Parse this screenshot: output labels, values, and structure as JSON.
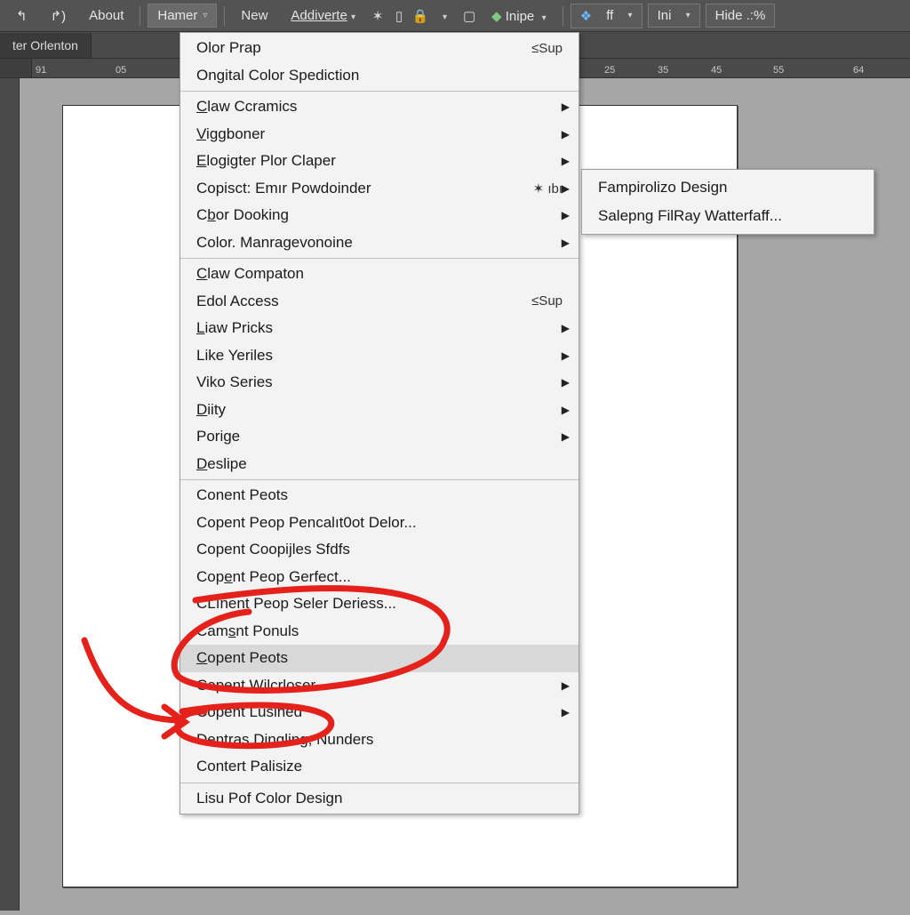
{
  "menubar": {
    "undo_redo": "↰",
    "redo": "↱",
    "about": "About",
    "hamer": "Hamer",
    "new": "New",
    "addiverte": "Addiverte",
    "inipe": "Inipe",
    "ff": "ff",
    "ini": "Ini",
    "hide": "Hide .:%"
  },
  "tab": {
    "title": "ter Orlenton"
  },
  "ruler": {
    "marks": [
      "91",
      "05",
      "25",
      "35",
      "45",
      "55",
      "64"
    ]
  },
  "menu": {
    "section1": [
      {
        "label": "Olor Prap",
        "shortcut": "≤Sup"
      },
      {
        "label": "Ongital Color Spediction"
      }
    ],
    "section2": [
      {
        "label": "Claw Ccramics",
        "u": 0,
        "sub": true
      },
      {
        "label": "Viggboner",
        "u": 0,
        "sub": true
      },
      {
        "label": "Elogigter Plor Claper",
        "u": 0,
        "sub": true
      },
      {
        "label": "Copisct: Emır Powdoinder",
        "shortcut": "✶ ıbı",
        "sub": true
      },
      {
        "label": "Cbor Dooking",
        "u": 1,
        "sub": true
      },
      {
        "label": "Color. Manragevonoine",
        "sub": true
      }
    ],
    "section3": [
      {
        "label": "Claw Compaton",
        "u": 0
      },
      {
        "label": "Edol Access",
        "shortcut": "≤Sup"
      },
      {
        "label": "Liaw Pricks",
        "u": 0,
        "sub": true
      },
      {
        "label": "Like Yeriles",
        "sub": true
      },
      {
        "label": "Viko Series",
        "sub": true
      },
      {
        "label": "Diity",
        "u": 0,
        "sub": true
      },
      {
        "label": "Porige",
        "sub": true
      },
      {
        "label": "Deslipe",
        "u": 0
      }
    ],
    "section4": [
      {
        "label": "Conent Peots"
      },
      {
        "label": "Copent Peop Pencalıt0ot Delor..."
      },
      {
        "label": "Copent Coopijles Sfdfs"
      },
      {
        "label": "Copent Peop Gerfect...",
        "u": 3
      },
      {
        "label": "CLınent Peop Seler Deriess..."
      },
      {
        "label": "Camsnt Ponuls",
        "u": 3
      },
      {
        "label": "Copent Peots",
        "u": 0,
        "hovered": true
      },
      {
        "label": "Copent Wilcrloser...",
        "sub": true
      },
      {
        "label": "Copent Lusihed",
        "sub": true
      },
      {
        "label": "Dentras Dingling, Nunders"
      },
      {
        "label": "Contert Palisize"
      }
    ],
    "section5": [
      {
        "label": "Lisu Pof Color Design"
      }
    ]
  },
  "submenu": {
    "items": [
      "Fampirolizo Design",
      "Salepng FilRay Watterfaff..."
    ]
  }
}
